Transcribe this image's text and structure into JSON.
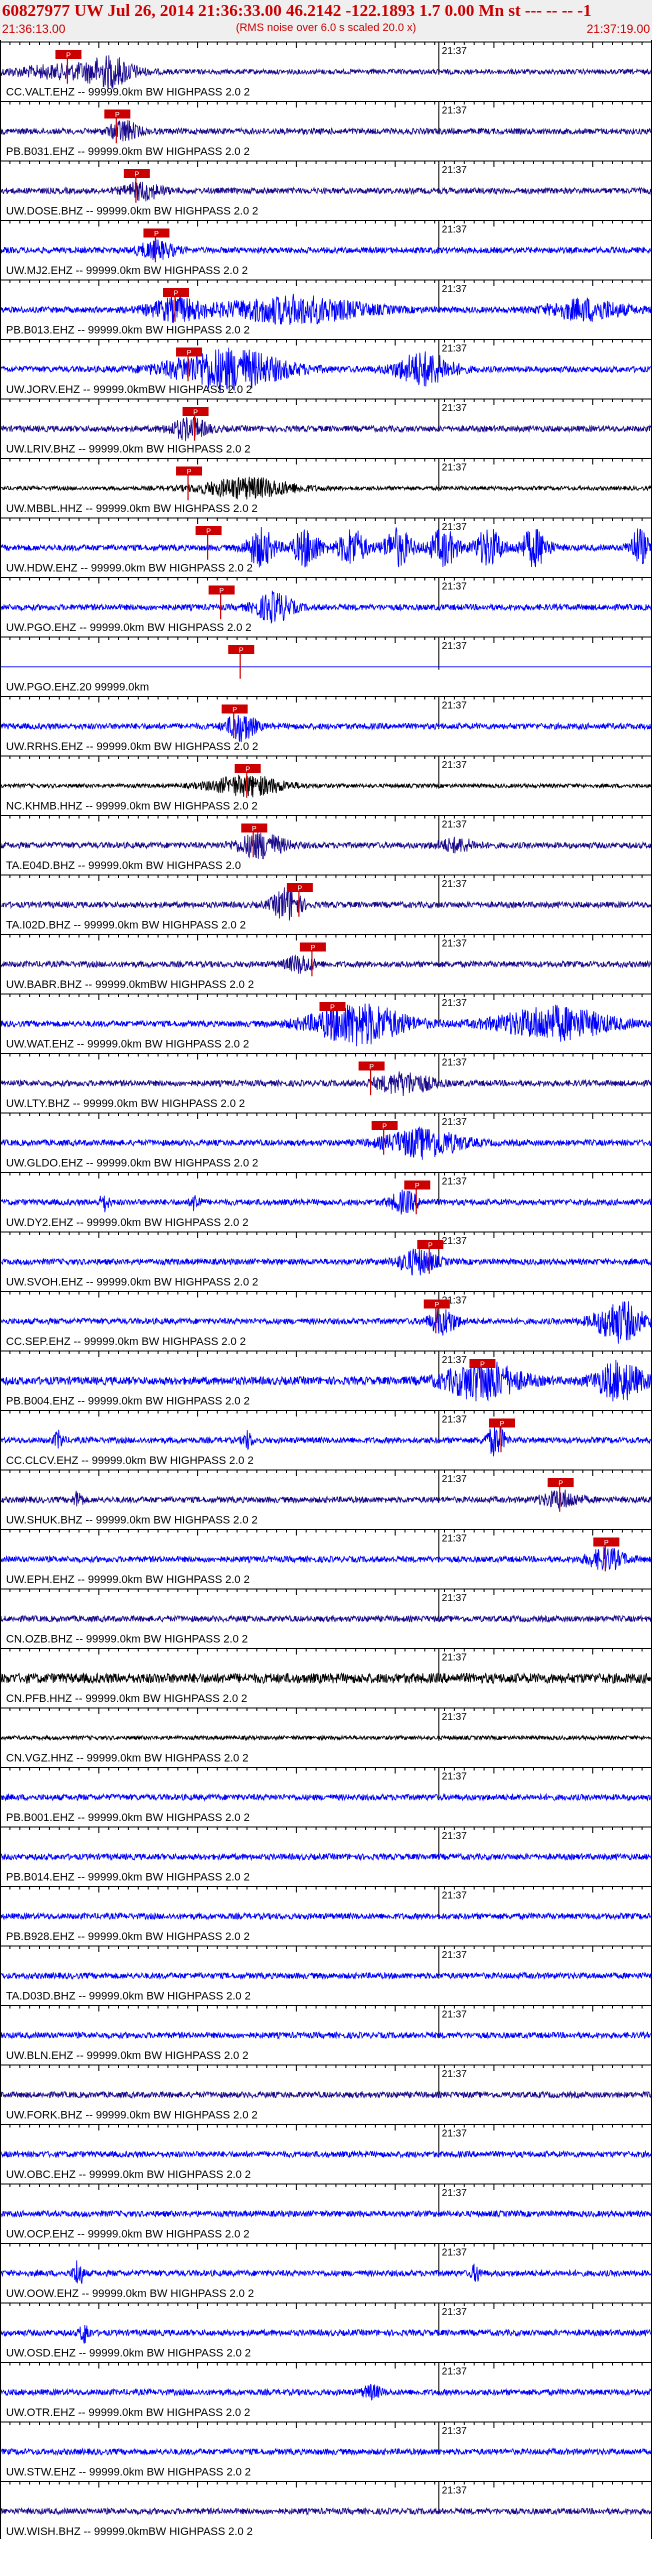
{
  "header": {
    "title": "60827977 UW Jul 26, 2014 21:36:33.00   46.2142 -122.1893  1.7 0.00 Mn st --- -- --   -1",
    "start_time": "21:36:13.00",
    "rms_note": "(RMS noise over 6.0 s scaled 20.0 x)",
    "end_time": "21:37:19.00"
  },
  "minute_label": "21:37",
  "colors": {
    "blue": "#0000ff",
    "indigo": "#1a0a8c",
    "black": "#000000",
    "pick": "#cc0000",
    "grid": "#000000"
  },
  "traces": [
    {
      "label": "CC.VALT.EHZ -- 99999.0km BW  HIGHPASS  2.0  2",
      "color": "indigo",
      "noise": 2.5,
      "bursts": [
        [
          0.1,
          0.12,
          6
        ],
        [
          0.17,
          0.05,
          12
        ]
      ],
      "pick": 0.085,
      "pick_label": "P"
    },
    {
      "label": "PB.B031.EHZ -- 99999.0km BW  HIGHPASS  2.0  2",
      "color": "indigo",
      "noise": 3,
      "bursts": [
        [
          0.19,
          0.03,
          10
        ]
      ],
      "pick": 0.16,
      "pick_label": "P"
    },
    {
      "label": "UW.DOSE.BHZ -- 99999.0km BW  HIGHPASS  2.0  2",
      "color": "indigo",
      "noise": 3,
      "bursts": [
        [
          0.22,
          0.04,
          8
        ]
      ],
      "pick": 0.19,
      "pick_label": "P"
    },
    {
      "label": "UW.MJ2.EHZ -- 99999.0km BW  HIGHPASS  2.0  2",
      "color": "blue",
      "noise": 3,
      "bursts": [
        [
          0.24,
          0.04,
          8
        ]
      ],
      "pick": 0.22,
      "pick_label": "P"
    },
    {
      "label": "PB.B013.EHZ -- 99999.0km BW  HIGHPASS  2.0  2",
      "color": "blue",
      "noise": 3,
      "bursts": [
        [
          0.27,
          0.06,
          10
        ],
        [
          0.45,
          0.15,
          13
        ],
        [
          0.9,
          0.08,
          10
        ]
      ],
      "pick": 0.25,
      "pick_label": "P"
    },
    {
      "label": "UW.JORV.EHZ -- 99999.0kmBW  HIGHPASS  2.0  2",
      "color": "blue",
      "noise": 3,
      "bursts": [
        [
          0.35,
          0.12,
          20
        ],
        [
          0.65,
          0.06,
          16
        ]
      ],
      "pick": 0.27,
      "pick_label": "P"
    },
    {
      "label": "UW.LRIV.BHZ -- 99999.0km BW  HIGHPASS  2.0  2",
      "color": "indigo",
      "noise": 3,
      "bursts": [
        [
          0.29,
          0.04,
          10
        ]
      ],
      "pick": 0.28,
      "pick_label": "P"
    },
    {
      "label": "UW.MBBL.HHZ -- 99999.0km BW  HIGHPASS  2.0  2",
      "color": "black",
      "noise": 2,
      "bursts": [
        [
          0.38,
          0.1,
          10
        ]
      ],
      "pick": 0.27,
      "pick_label": "P"
    },
    {
      "label": "UW.HDW.EHZ -- 99999.0km BW  HIGHPASS  2.0  2",
      "color": "blue",
      "noise": 3,
      "bursts": [
        [
          0.4,
          0.03,
          18
        ],
        [
          0.47,
          0.03,
          18
        ],
        [
          0.54,
          0.03,
          18
        ],
        [
          0.61,
          0.03,
          18
        ],
        [
          0.68,
          0.03,
          18
        ],
        [
          0.75,
          0.03,
          18
        ],
        [
          0.82,
          0.03,
          18
        ],
        [
          0.98,
          0.02,
          18
        ]
      ],
      "pick": 0.3,
      "pick_label": "P"
    },
    {
      "label": "UW.PGO.EHZ -- 99999.0km BW  HIGHPASS  2.0  2",
      "color": "blue",
      "noise": 3,
      "bursts": [
        [
          0.42,
          0.04,
          14
        ]
      ],
      "pick": 0.32,
      "pick_label": "P"
    },
    {
      "label": "UW.PGO.EHZ.20  99999.0km",
      "color": "blue",
      "noise": 0,
      "bursts": [],
      "pick": 0.35,
      "pick_label": "P"
    },
    {
      "label": "UW.RRHS.EHZ -- 99999.0km BW  HIGHPASS  2.0  2",
      "color": "blue",
      "noise": 3,
      "bursts": [
        [
          0.37,
          0.03,
          14
        ]
      ],
      "pick": 0.34,
      "pick_label": "P"
    },
    {
      "label": "NC.KHMB.HHZ -- 99999.0km BW  HIGHPASS  2.0  2",
      "color": "black",
      "noise": 2,
      "bursts": [
        [
          0.38,
          0.08,
          10
        ]
      ],
      "pick": 0.36,
      "pick_label": "P"
    },
    {
      "label": "TA.E04D.BHZ -- 99999.0km BW  HIGHPASS  2.0",
      "color": "indigo",
      "noise": 3,
      "bursts": [
        [
          0.4,
          0.05,
          12
        ],
        [
          0.7,
          0.04,
          6
        ]
      ],
      "pick": 0.37,
      "pick_label": "P"
    },
    {
      "label": "TA.I02D.BHZ -- 99999.0km BW  HIGHPASS  2.0  2",
      "color": "indigo",
      "noise": 3,
      "bursts": [
        [
          0.44,
          0.03,
          16
        ]
      ],
      "pick": 0.44,
      "pick_label": "P"
    },
    {
      "label": "UW.BABR.BHZ -- 99999.0kmBW  HIGHPASS  2.0  2",
      "color": "indigo",
      "noise": 3,
      "bursts": [
        [
          0.46,
          0.03,
          8
        ]
      ],
      "pick": 0.46,
      "pick_label": "P"
    },
    {
      "label": "UW.WAT.EHZ -- 99999.0km BW  HIGHPASS  2.0  2",
      "color": "blue",
      "noise": 3,
      "bursts": [
        [
          0.55,
          0.1,
          20
        ],
        [
          0.85,
          0.12,
          16
        ]
      ],
      "pick": 0.49,
      "pick_label": "P"
    },
    {
      "label": "UW.LTY.BHZ -- 99999.0km BW  HIGHPASS  2.0  2",
      "color": "indigo",
      "noise": 3,
      "bursts": [
        [
          0.62,
          0.06,
          10
        ]
      ],
      "pick": 0.55,
      "pick_label": "P"
    },
    {
      "label": "UW.GLDO.EHZ -- 99999.0km BW  HIGHPASS  2.0  2",
      "color": "blue",
      "noise": 3,
      "bursts": [
        [
          0.65,
          0.08,
          14
        ]
      ],
      "pick": 0.57,
      "pick_label": "P"
    },
    {
      "label": "UW.DY2.EHZ -- 99999.0km BW  HIGHPASS  2.0  2",
      "color": "blue",
      "noise": 3,
      "bursts": [
        [
          0.16,
          0.01,
          8
        ],
        [
          0.3,
          0.01,
          8
        ],
        [
          0.62,
          0.03,
          10
        ]
      ],
      "pick": 0.62,
      "pick_label": "P"
    },
    {
      "label": "UW.SVOH.EHZ -- 99999.0km BW  HIGHPASS  2.0  2",
      "color": "blue",
      "noise": 3,
      "bursts": [
        [
          0.64,
          0.04,
          12
        ]
      ],
      "pick": 0.64,
      "pick_label": "P"
    },
    {
      "label": "CC.SEP.EHZ -- 99999.0km BW  HIGHPASS  2.0  2",
      "color": "blue",
      "noise": 3,
      "bursts": [
        [
          0.68,
          0.03,
          12
        ],
        [
          0.95,
          0.05,
          20
        ]
      ],
      "pick": 0.65,
      "pick_label": "P"
    },
    {
      "label": "PB.B004.EHZ -- 99999.0km BW  HIGHPASS  2.0  2",
      "color": "blue",
      "noise": 4,
      "bursts": [
        [
          0.74,
          0.08,
          18
        ],
        [
          0.95,
          0.05,
          18
        ]
      ],
      "pick": 0.72,
      "pick_label": "P"
    },
    {
      "label": "CC.CLCV.EHZ -- 99999.0km BW  HIGHPASS  2.0  2",
      "color": "blue",
      "noise": 3,
      "bursts": [
        [
          0.09,
          0.01,
          8
        ],
        [
          0.38,
          0.01,
          8
        ],
        [
          0.76,
          0.02,
          14
        ]
      ],
      "pick": 0.75,
      "pick_label": "P"
    },
    {
      "label": "UW.SHUK.BHZ -- 99999.0km BW  HIGHPASS  2.0  2",
      "color": "indigo",
      "noise": 3,
      "bursts": [
        [
          0.12,
          0.01,
          8
        ],
        [
          0.86,
          0.04,
          8
        ]
      ],
      "pick": 0.84,
      "pick_label": "P"
    },
    {
      "label": "UW.EPH.EHZ -- 99999.0km BW  HIGHPASS  2.0  2",
      "color": "blue",
      "noise": 3,
      "bursts": [
        [
          0.93,
          0.04,
          10
        ]
      ],
      "pick": 0.91,
      "pick_label": "P"
    },
    {
      "label": "CN.OZB.BHZ -- 99999.0km BW  HIGHPASS  2.0  2",
      "color": "indigo",
      "noise": 3,
      "bursts": [],
      "pick": null,
      "pick_label": ""
    },
    {
      "label": "CN.PFB.HHZ -- 99999.0km BW  HIGHPASS  2.0  2",
      "color": "black",
      "noise": 5,
      "bursts": [],
      "pick": null,
      "pick_label": ""
    },
    {
      "label": "CN.VGZ.HHZ -- 99999.0km BW  HIGHPASS  2.0  2",
      "color": "black",
      "noise": 2,
      "bursts": [],
      "pick": null,
      "pick_label": ""
    },
    {
      "label": "PB.B001.EHZ -- 99999.0km BW  HIGHPASS  2.0  2",
      "color": "blue",
      "noise": 3,
      "bursts": [],
      "pick": null,
      "pick_label": ""
    },
    {
      "label": "PB.B014.EHZ -- 99999.0km BW  HIGHPASS  2.0  2",
      "color": "blue",
      "noise": 3,
      "bursts": [],
      "pick": null,
      "pick_label": ""
    },
    {
      "label": "PB.B928.EHZ -- 99999.0km BW  HIGHPASS  2.0  2",
      "color": "blue",
      "noise": 3,
      "bursts": [],
      "pick": null,
      "pick_label": ""
    },
    {
      "label": "TA.D03D.BHZ -- 99999.0km BW  HIGHPASS  2.0  2",
      "color": "blue",
      "noise": 3,
      "bursts": [],
      "pick": null,
      "pick_label": ""
    },
    {
      "label": "UW.BLN.EHZ -- 99999.0km BW  HIGHPASS  2.0  2",
      "color": "blue",
      "noise": 3,
      "bursts": [],
      "pick": null,
      "pick_label": ""
    },
    {
      "label": "UW.FORK.BHZ -- 99999.0km BW  HIGHPASS  2.0  2",
      "color": "indigo",
      "noise": 3,
      "bursts": [],
      "pick": null,
      "pick_label": ""
    },
    {
      "label": "UW.OBC.EHZ -- 99999.0km BW  HIGHPASS  2.0  2",
      "color": "blue",
      "noise": 3,
      "bursts": [],
      "pick": null,
      "pick_label": ""
    },
    {
      "label": "UW.OCP.EHZ -- 99999.0km BW  HIGHPASS  2.0  2",
      "color": "blue",
      "noise": 3,
      "bursts": [],
      "pick": null,
      "pick_label": ""
    },
    {
      "label": "UW.OOW.EHZ -- 99999.0km BW  HIGHPASS  2.0  2",
      "color": "blue",
      "noise": 3,
      "bursts": [
        [
          0.12,
          0.01,
          14
        ],
        [
          0.73,
          0.01,
          8
        ]
      ],
      "pick": null,
      "pick_label": ""
    },
    {
      "label": "UW.OSD.EHZ -- 99999.0km BW  HIGHPASS  2.0  2",
      "color": "blue",
      "noise": 3,
      "bursts": [
        [
          0.13,
          0.01,
          10
        ]
      ],
      "pick": null,
      "pick_label": ""
    },
    {
      "label": "UW.OTR.EHZ -- 99999.0km BW  HIGHPASS  2.0  2",
      "color": "blue",
      "noise": 3,
      "bursts": [
        [
          0.57,
          0.02,
          6
        ]
      ],
      "pick": null,
      "pick_label": ""
    },
    {
      "label": "UW.STW.EHZ -- 99999.0km BW  HIGHPASS  2.0  2",
      "color": "blue",
      "noise": 3,
      "bursts": [],
      "pick": null,
      "pick_label": ""
    },
    {
      "label": "UW.WISH.BHZ -- 99999.0kmBW  HIGHPASS  2.0  2",
      "color": "indigo",
      "noise": 3,
      "bursts": [],
      "pick": null,
      "pick_label": ""
    }
  ]
}
